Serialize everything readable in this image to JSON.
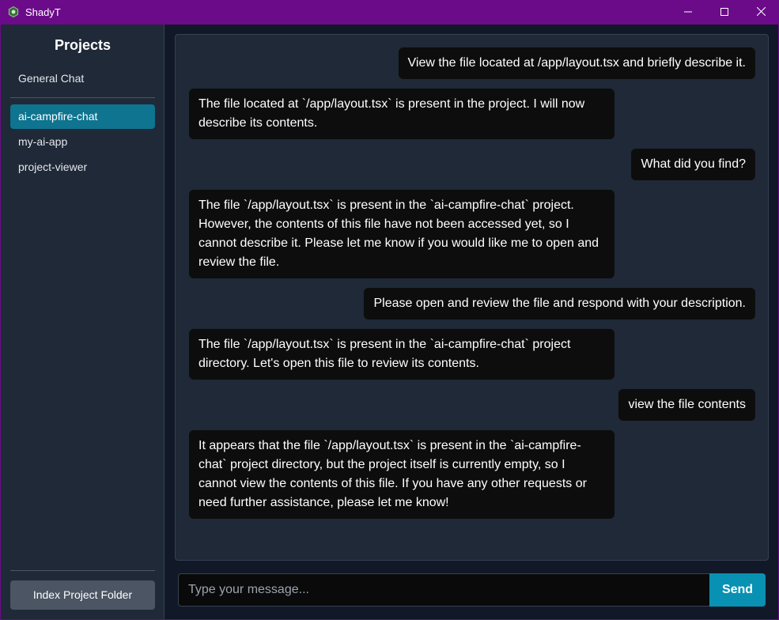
{
  "window": {
    "title": "ShadyT",
    "icon": "app-logo-icon",
    "controls": [
      "minimize-icon",
      "maximize-icon",
      "close-icon"
    ]
  },
  "sidebar": {
    "title": "Projects",
    "general_chat": "General Chat",
    "projects": [
      {
        "label": "ai-campfire-chat",
        "active": true
      },
      {
        "label": "my-ai-app",
        "active": false
      },
      {
        "label": "project-viewer",
        "active": false
      }
    ],
    "index_button": "Index Project Folder"
  },
  "messages": [
    {
      "role": "user",
      "text": "View the file located at /app/layout.tsx and briefly describe it."
    },
    {
      "role": "assistant",
      "text": "The file located at `/app/layout.tsx` is present in the project. I will now describe its contents."
    },
    {
      "role": "user",
      "text": "What did you find?"
    },
    {
      "role": "assistant",
      "text": "The file `/app/layout.tsx` is present in the `ai-campfire-chat` project. However, the contents of this file have not been accessed yet, so I cannot describe it. Please let me know if you would like me to open and review the file."
    },
    {
      "role": "user",
      "text": "Please open and review the file and respond with your description."
    },
    {
      "role": "assistant",
      "text": "The file `/app/layout.tsx` is present in the `ai-campfire-chat` project directory. Let's open this file to review its contents."
    },
    {
      "role": "user",
      "text": "view the file contents"
    },
    {
      "role": "assistant",
      "text": "It appears that the file `/app/layout.tsx` is present in the `ai-campfire-chat` project directory, but the project itself is currently empty, so I cannot view the contents of this file. If you have any other requests or need further assistance, please let me know!"
    }
  ],
  "composer": {
    "placeholder": "Type your message...",
    "value": "",
    "send_label": "Send"
  },
  "colors": {
    "titlebar": "#6b0b8a",
    "accent": "#0891b2",
    "active_project": "#0e7490",
    "bubble": "#0d0d0d",
    "panel": "#1f2937"
  }
}
